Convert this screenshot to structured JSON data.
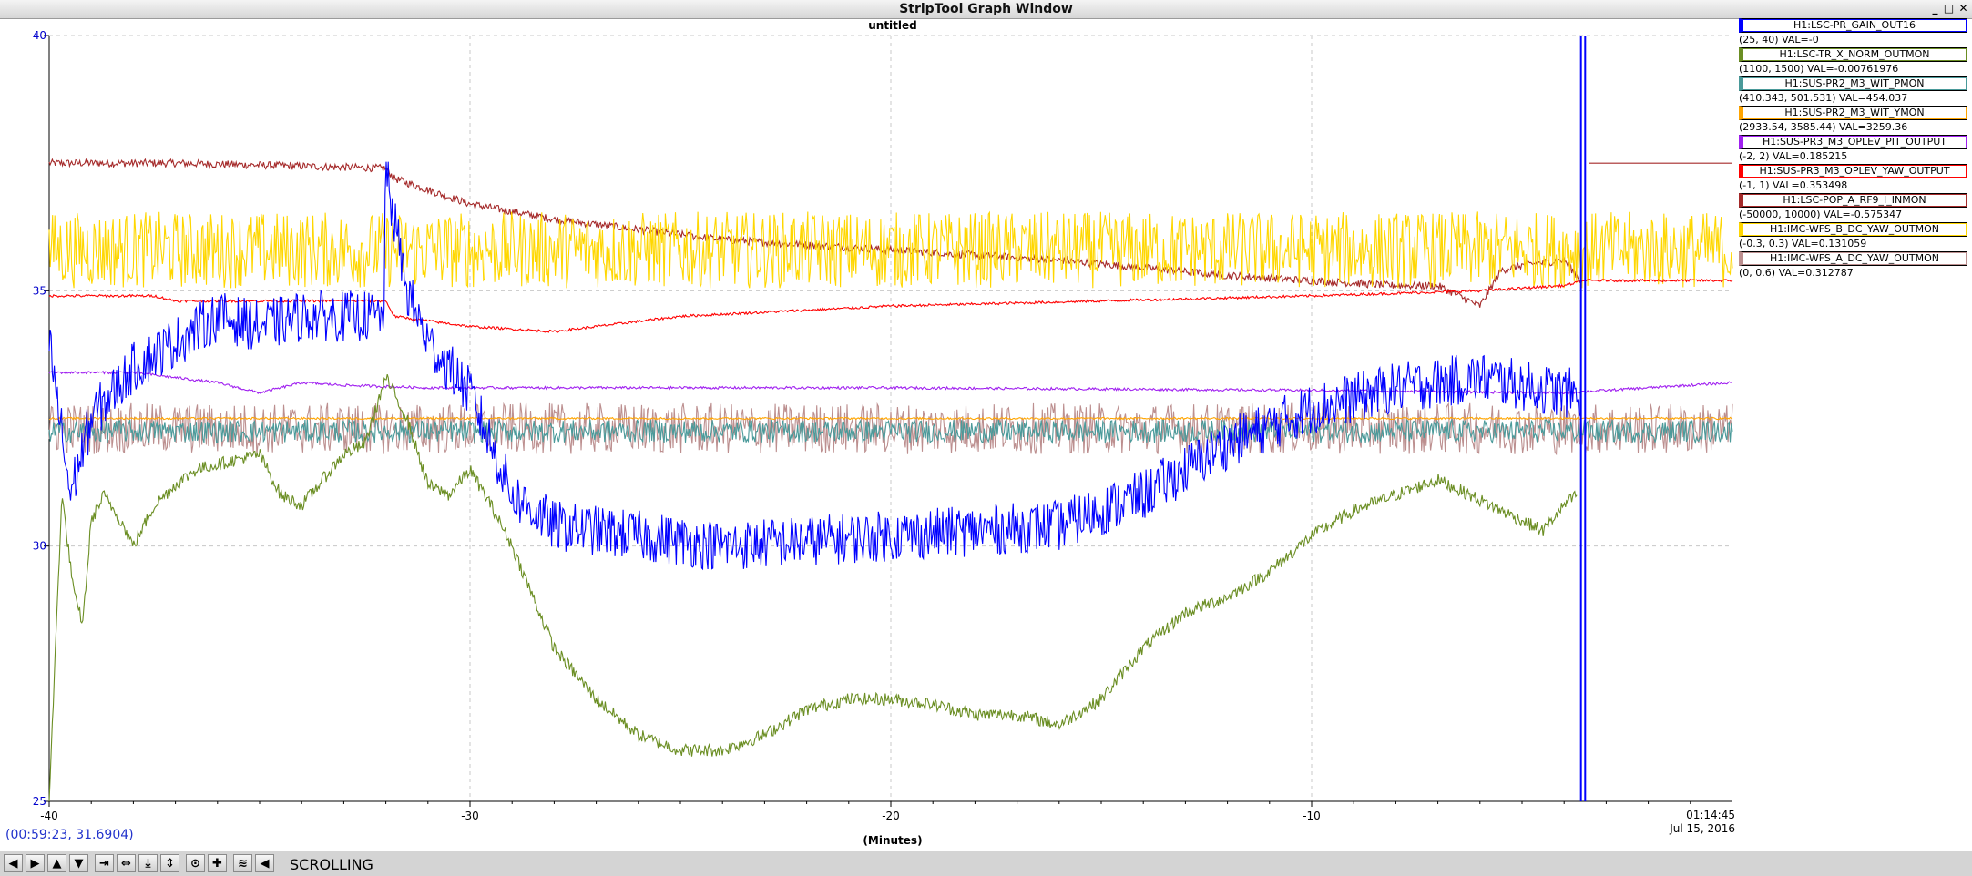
{
  "window": {
    "title": "StripTool Graph Window",
    "min_icon": "_",
    "max_icon": "□",
    "close_icon": "✕"
  },
  "graph": {
    "title": "untitled",
    "x_axis_label": "(Minutes)",
    "current_time": "01:14:45",
    "current_date": "Jul 15, 2016",
    "cursor_readout": "(00:59:23, 31.6904)"
  },
  "legend": [
    {
      "name": "H1:LSC-PR_GAIN_OUT16",
      "range": "(25, 40) VAL=-0",
      "color": "#0000ff"
    },
    {
      "name": "H1:LSC-TR_X_NORM_OUTMON",
      "range": "(1100, 1500) VAL=-0.00761976",
      "color": "#6b8e23"
    },
    {
      "name": "H1:SUS-PR2_M3_WIT_PMON",
      "range": "(410.343, 501.531) VAL=454.037",
      "color": "#4a9a9a"
    },
    {
      "name": "H1:SUS-PR2_M3_WIT_YMON",
      "range": "(2933.54, 3585.44) VAL=3259.36",
      "color": "#ffa500"
    },
    {
      "name": "H1:SUS-PR3_M3_OPLEV_PIT_OUTPUT",
      "range": "(-2, 2) VAL=0.185215",
      "color": "#a020f0"
    },
    {
      "name": "H1:SUS-PR3_M3_OPLEV_YAW_OUTPUT",
      "range": "(-1, 1) VAL=0.353498",
      "color": "#ff0000"
    },
    {
      "name": "H1:LSC-POP_A_RF9_I_INMON",
      "range": "(-50000, 10000) VAL=-0.575347",
      "color": "#a52a2a"
    },
    {
      "name": "H1:IMC-WFS_B_DC_YAW_OUTMON",
      "range": "(-0.3, 0.3) VAL=0.131059",
      "color": "#ffd700"
    },
    {
      "name": "H1:IMC-WFS_A_DC_YAW_OUTMON",
      "range": "(0, 0.6) VAL=0.312787",
      "color": "#bc8f8f"
    }
  ],
  "toolbar": {
    "buttons": [
      {
        "name": "scroll-left-button",
        "glyph": "◀"
      },
      {
        "name": "scroll-right-button",
        "glyph": "▶"
      },
      {
        "name": "scroll-up-button",
        "glyph": "▲"
      },
      {
        "name": "scroll-down-button",
        "glyph": "▼"
      },
      {
        "name": "zoom-x-in-button",
        "glyph": "⇥"
      },
      {
        "name": "zoom-x-out-button",
        "glyph": "⇔"
      },
      {
        "name": "zoom-y-in-button",
        "glyph": "⤓"
      },
      {
        "name": "zoom-y-out-button",
        "glyph": "⇕"
      },
      {
        "name": "autoscale-button",
        "glyph": "⊙"
      },
      {
        "name": "add-button",
        "glyph": "✚"
      },
      {
        "name": "graph-toggle-button",
        "glyph": "≋"
      },
      {
        "name": "scroll-resume-button",
        "glyph": "◀"
      }
    ],
    "mode": "SCROLLING"
  },
  "chart_data": {
    "type": "line",
    "title": "untitled",
    "xlabel": "(Minutes)",
    "ylabel": "",
    "xlim": [
      -40,
      0
    ],
    "ylim": [
      25,
      40
    ],
    "x_ticks": [
      -40,
      -30,
      -20,
      -10
    ],
    "y_ticks": [
      25,
      30,
      35,
      40
    ],
    "grid": true,
    "legend_placement": "right",
    "series": [
      {
        "name": "H1:LSC-PR_GAIN_OUT16",
        "color": "#0000ff",
        "noise": 1.0,
        "x": [
          -40,
          -39.5,
          -39,
          -38,
          -37,
          -36,
          -35,
          -34,
          -33,
          -32.05,
          -32,
          -31.5,
          -31,
          -30.5,
          -30,
          -29.5,
          -29,
          -28,
          -26,
          -24,
          -22,
          -20,
          -18,
          -16,
          -14,
          -12,
          -10,
          -8,
          -6,
          -4,
          -3.6
        ],
        "y": [
          34,
          31,
          32.5,
          33.5,
          34,
          34.5,
          34.3,
          34.5,
          34.5,
          34.5,
          37.3,
          35,
          34,
          33.5,
          33,
          32,
          31,
          30.4,
          30.2,
          30,
          30.1,
          30.2,
          30.3,
          30.4,
          31,
          32,
          32.7,
          33.1,
          33.3,
          33.0,
          33.0
        ]
      },
      {
        "name": "H1:LSC-TR_X_NORM_OUTMON",
        "color": "#6b8e23",
        "noise": 0.25,
        "x": [
          -40,
          -39.7,
          -39.4,
          -39.2,
          -39.0,
          -38.7,
          -38.3,
          -38.0,
          -37.5,
          -37,
          -36.5,
          -36,
          -35.5,
          -35,
          -34.5,
          -34.0,
          -33.5,
          -33,
          -32.5,
          -32.0,
          -31.5,
          -31,
          -30.5,
          -30,
          -29.5,
          -29.0,
          -28.5,
          -28,
          -27,
          -26,
          -25,
          -24,
          -23,
          -22,
          -21,
          -20,
          -19,
          -18,
          -17,
          -16,
          -15,
          -14,
          -13,
          -12,
          -11,
          -10,
          -9,
          -8,
          -7,
          -6,
          -5,
          -4.5,
          -4,
          -3.7
        ],
        "y": [
          25,
          31,
          29,
          28.5,
          30.5,
          31,
          30.5,
          30,
          30.8,
          31.2,
          31.5,
          31.6,
          31.7,
          31.8,
          31.0,
          30.8,
          31.3,
          31.8,
          32,
          33.3,
          32.5,
          31.2,
          31.0,
          31.5,
          30.8,
          30.0,
          29.0,
          28.0,
          27.0,
          26.3,
          26.0,
          26.0,
          26.3,
          26.8,
          27.0,
          27.0,
          26.9,
          26.7,
          26.7,
          26.5,
          27.0,
          28.0,
          28.7,
          29.0,
          29.5,
          30.2,
          30.7,
          31.0,
          31.3,
          30.9,
          30.5,
          30.3,
          30.8,
          31.0
        ]
      },
      {
        "name": "H1:SUS-PR2_M3_WIT_PMON",
        "color": "#4a9a9a",
        "noise": 0.45,
        "x": [
          -40,
          0
        ],
        "y": [
          32.25,
          32.25
        ]
      },
      {
        "name": "H1:SUS-PR2_M3_WIT_YMON",
        "color": "#ffa500",
        "noise": 0.04,
        "x": [
          -40,
          0
        ],
        "y": [
          32.5,
          32.5
        ]
      },
      {
        "name": "H1:SUS-PR3_M3_OPLEV_PIT_OUTPUT",
        "color": "#a020f0",
        "noise": 0.05,
        "x": [
          -40,
          -38,
          -36,
          -35,
          -34,
          -33,
          -31,
          -28,
          -20,
          -10,
          -4,
          0
        ],
        "y": [
          33.4,
          33.4,
          33.2,
          33.0,
          33.2,
          33.15,
          33.1,
          33.1,
          33.1,
          33.05,
          33.0,
          33.2
        ]
      },
      {
        "name": "H1:SUS-PR3_M3_OPLEV_YAW_OUTPUT",
        "color": "#ff0000",
        "noise": 0.05,
        "x": [
          -40,
          -37.5,
          -37,
          -35,
          -33,
          -32,
          -31.8,
          -30,
          -28,
          -25,
          -20,
          -15,
          -10,
          -6,
          -4,
          -3.5,
          0
        ],
        "y": [
          34.9,
          34.9,
          34.8,
          34.8,
          34.8,
          34.8,
          34.5,
          34.3,
          34.2,
          34.5,
          34.7,
          34.8,
          34.9,
          35.0,
          35.1,
          35.2,
          35.2
        ]
      },
      {
        "name": "H1:LSC-POP_A_RF9_I_INMON",
        "color": "#a52a2a",
        "noise": 0.15,
        "x": [
          -40,
          -37,
          -32,
          -31.8,
          -30,
          -28,
          -26,
          -24,
          -20,
          -16,
          -12,
          -8,
          -7,
          -6,
          -5.5,
          -5,
          -4,
          -3.6
        ],
        "y": [
          37.5,
          37.5,
          37.4,
          37.2,
          36.7,
          36.4,
          36.2,
          36.0,
          35.8,
          35.6,
          35.3,
          35.1,
          35.1,
          34.7,
          35.4,
          35.5,
          35.6,
          35.2
        ]
      },
      {
        "name": "H1:IMC-WFS_B_DC_YAW_OUTMON",
        "color": "#ffd700",
        "noise": 1.5,
        "x": [
          -40,
          0
        ],
        "y": [
          35.8,
          35.8
        ]
      },
      {
        "name": "H1:IMC-WFS_A_DC_YAW_OUTMON",
        "color": "#bc8f8f",
        "noise": 1.0,
        "x": [
          -40,
          0
        ],
        "y": [
          32.3,
          32.3
        ]
      }
    ]
  }
}
